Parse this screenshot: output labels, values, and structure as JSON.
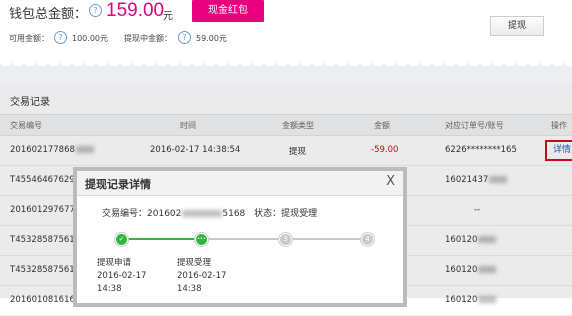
{
  "wallet": {
    "total_label": "钱包总金额：",
    "total_amount": "159.00",
    "total_unit": "元",
    "redpack_button": "现金红包",
    "available_label": "可用金额：",
    "available_value": "100.00元",
    "pending_label": "提现中金额：",
    "pending_value": "59.00元",
    "withdraw_button": "提现",
    "help_glyph": "?"
  },
  "transactions": {
    "title": "交易记录",
    "headers": [
      "交易编号",
      "时间",
      "金额类型",
      "金额",
      "对应订单号/账号",
      "操作"
    ],
    "rows": [
      {
        "id": "201602177868",
        "time": "2016-02-17 14:38:54",
        "type": "提现",
        "amount": "-59.00",
        "account": "6226********165",
        "action": "详情"
      },
      {
        "id": "T4554646762945",
        "time": "",
        "type": "",
        "amount": "",
        "account": "16021437",
        "action": ""
      },
      {
        "id": "201601297677806",
        "time": "",
        "type": "",
        "amount": "",
        "account": "--",
        "action": ""
      },
      {
        "id": "T4532858756137",
        "time": "",
        "type": "",
        "amount": "",
        "account": "160120",
        "action": ""
      },
      {
        "id": "T4532858756137",
        "time": "",
        "type": "",
        "amount": "",
        "account": "160120",
        "action": ""
      },
      {
        "id": "201601081616",
        "time": "",
        "type": "",
        "amount": "",
        "account": "160120",
        "action": ""
      }
    ]
  },
  "modal": {
    "title": "提现记录详情",
    "close_glyph": "X",
    "txn_label": "交易编号：",
    "txn_prefix": "201602",
    "txn_suffix": "5168",
    "status_label": "状态：",
    "status_value": "提现受理",
    "steps": [
      {
        "glyph": "✓",
        "state": "done",
        "label": "提现申请",
        "date": "2016-02-17",
        "time": "14:38"
      },
      {
        "glyph": "•••",
        "state": "current",
        "label": "提现受理",
        "date": "2016-02-17",
        "time": "14:38"
      },
      {
        "glyph": "3",
        "state": "todo",
        "label": "",
        "date": "",
        "time": ""
      },
      {
        "glyph": "4",
        "state": "todo",
        "label": "",
        "date": "",
        "time": ""
      }
    ],
    "colors": {
      "done": "#2db83d",
      "todo": "#c9c9c9"
    }
  },
  "colors": {
    "accent": "#e8007d",
    "amount": "#e4007f",
    "negative": "#e4001b",
    "link": "#1a5fb4"
  }
}
